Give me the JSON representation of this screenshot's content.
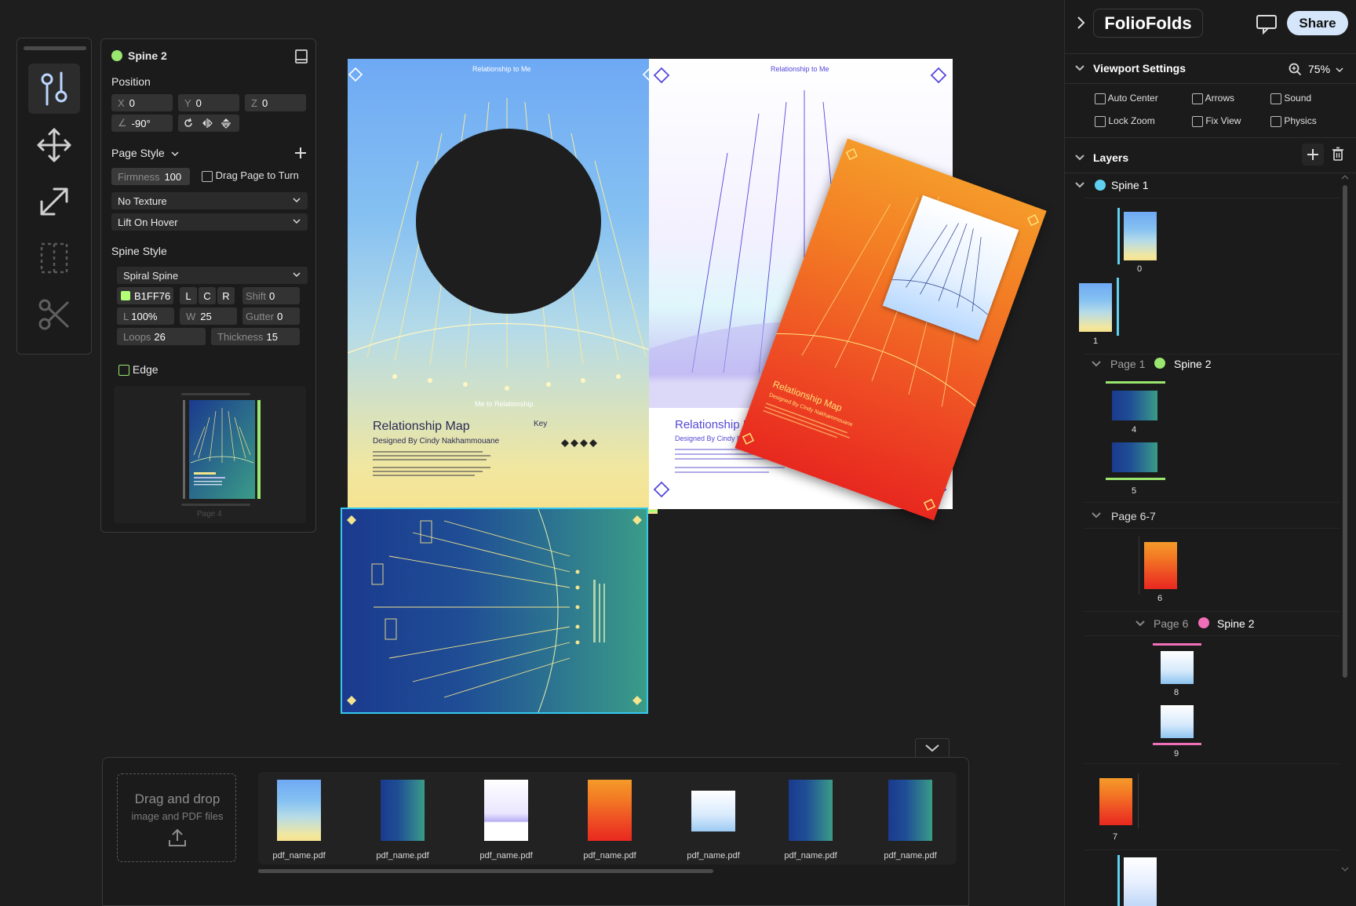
{
  "app": {
    "name": "FolioFolds",
    "share_label": "Share"
  },
  "properties": {
    "object_name": "Spine 2",
    "object_color": "#9ae66e",
    "position_label": "Position",
    "x": {
      "key": "X",
      "value": "0"
    },
    "y": {
      "key": "Y",
      "value": "0"
    },
    "z": {
      "key": "Z",
      "value": "0"
    },
    "angle": {
      "key": "∠",
      "value": "-90°"
    },
    "page_style_label": "Page Style",
    "firmness": {
      "key": "Firmness",
      "value": "100"
    },
    "drag_page_label": "Drag Page to Turn",
    "texture": "No Texture",
    "hover": "Lift On Hover",
    "spine_style_label": "Spine Style",
    "spine_type": "Spiral Spine",
    "spine_color": "B1FF76",
    "align_l": "L",
    "align_c": "C",
    "align_r": "R",
    "shift": {
      "key": "Shift",
      "value": "0"
    },
    "length": {
      "key": "L",
      "value": "100%"
    },
    "width": {
      "key": "W",
      "value": "25"
    },
    "gutter": {
      "key": "Gutter",
      "value": "0"
    },
    "loops": {
      "key": "Loops",
      "value": "26"
    },
    "thickness": {
      "key": "Thickness",
      "value": "15"
    },
    "edge_label": "Edge",
    "preview_caption": "Page 4"
  },
  "viewport": {
    "title": "Viewport  Settings",
    "zoom": "75%",
    "options": [
      "Auto Center",
      "Arrows",
      "Sound",
      "Lock Zoom",
      "Fix View",
      "Physics"
    ]
  },
  "layers": {
    "title": "Layers",
    "spine1": {
      "label": "Spine 1",
      "color": "#5fd0ef"
    },
    "page1_label": "Page 1",
    "spine2": {
      "label": "Spine 2",
      "color": "#9ae66e"
    },
    "page67_label": "Page 6-7",
    "page6_label": "Page 6",
    "spine2b": {
      "label": "Spine 2",
      "color": "#f06fb8"
    },
    "thumb_numbers": [
      "0",
      "1",
      "4",
      "5",
      "6",
      "8",
      "9",
      "7"
    ]
  },
  "book_text": {
    "rel_to_me": "Relationship to Me",
    "me_to_rel": "Me to Relationship",
    "title": "Relationship Map",
    "designer": "Designed By Cindy Nakhammouane",
    "key": "Key"
  },
  "tray": {
    "drop_title": "Drag and drop",
    "drop_sub": "image and PDF files",
    "files": [
      "pdf_name.pdf",
      "pdf_name.pdf",
      "pdf_name.pdf",
      "pdf_name.pdf",
      "pdf_name.pdf",
      "pdf_name.pdf",
      "pdf_name.pdf"
    ]
  }
}
